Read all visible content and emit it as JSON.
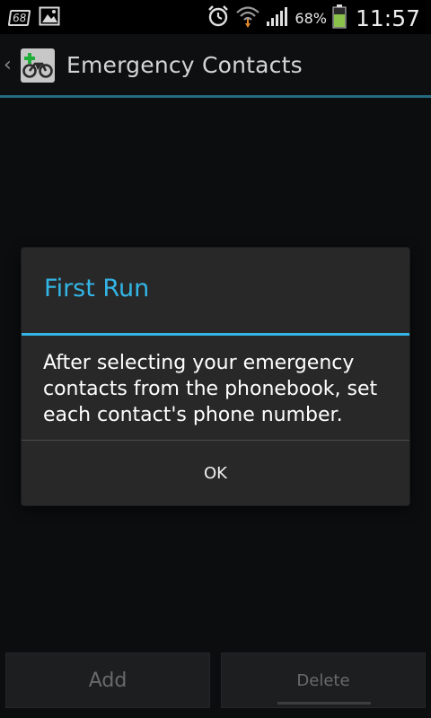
{
  "status_bar": {
    "notification_count": "68",
    "battery_percent": "68%",
    "time": "11:57",
    "icons": [
      "notification-counter-icon",
      "image-icon",
      "alarm-icon",
      "wifi-icon",
      "signal-icon",
      "battery-icon"
    ],
    "battery_color": "#8bc34a"
  },
  "action_bar": {
    "title": "Emergency Contacts",
    "divider_color": "#256a80"
  },
  "dialog": {
    "title": "First Run",
    "message": "After selecting your emergency contacts from the phonebook, set each contact's phone number.",
    "ok_label": "OK",
    "accent_color": "#33b5e5"
  },
  "bottom_bar": {
    "add_label": "Add",
    "delete_label": "Delete"
  }
}
